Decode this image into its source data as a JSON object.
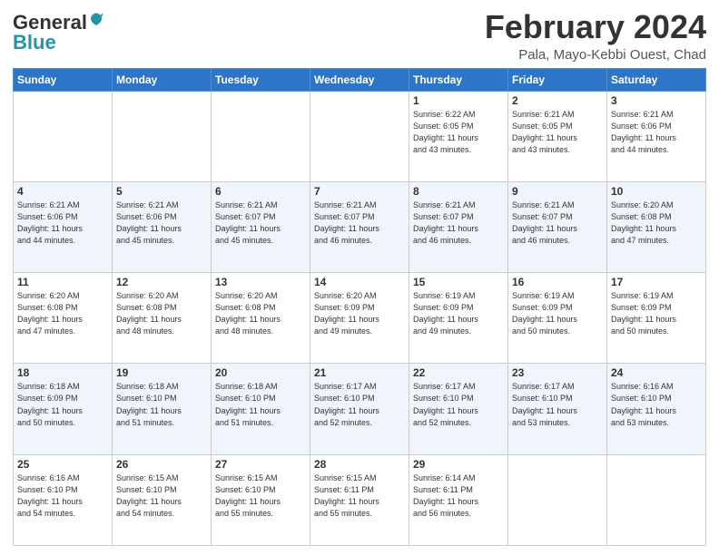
{
  "header": {
    "logo_line1": "General",
    "logo_line2": "Blue",
    "month": "February 2024",
    "location": "Pala, Mayo-Kebbi Ouest, Chad"
  },
  "days_of_week": [
    "Sunday",
    "Monday",
    "Tuesday",
    "Wednesday",
    "Thursday",
    "Friday",
    "Saturday"
  ],
  "weeks": [
    [
      {
        "day": "",
        "info": ""
      },
      {
        "day": "",
        "info": ""
      },
      {
        "day": "",
        "info": ""
      },
      {
        "day": "",
        "info": ""
      },
      {
        "day": "1",
        "info": "Sunrise: 6:22 AM\nSunset: 6:05 PM\nDaylight: 11 hours\nand 43 minutes."
      },
      {
        "day": "2",
        "info": "Sunrise: 6:21 AM\nSunset: 6:05 PM\nDaylight: 11 hours\nand 43 minutes."
      },
      {
        "day": "3",
        "info": "Sunrise: 6:21 AM\nSunset: 6:06 PM\nDaylight: 11 hours\nand 44 minutes."
      }
    ],
    [
      {
        "day": "4",
        "info": "Sunrise: 6:21 AM\nSunset: 6:06 PM\nDaylight: 11 hours\nand 44 minutes."
      },
      {
        "day": "5",
        "info": "Sunrise: 6:21 AM\nSunset: 6:06 PM\nDaylight: 11 hours\nand 45 minutes."
      },
      {
        "day": "6",
        "info": "Sunrise: 6:21 AM\nSunset: 6:07 PM\nDaylight: 11 hours\nand 45 minutes."
      },
      {
        "day": "7",
        "info": "Sunrise: 6:21 AM\nSunset: 6:07 PM\nDaylight: 11 hours\nand 46 minutes."
      },
      {
        "day": "8",
        "info": "Sunrise: 6:21 AM\nSunset: 6:07 PM\nDaylight: 11 hours\nand 46 minutes."
      },
      {
        "day": "9",
        "info": "Sunrise: 6:21 AM\nSunset: 6:07 PM\nDaylight: 11 hours\nand 46 minutes."
      },
      {
        "day": "10",
        "info": "Sunrise: 6:20 AM\nSunset: 6:08 PM\nDaylight: 11 hours\nand 47 minutes."
      }
    ],
    [
      {
        "day": "11",
        "info": "Sunrise: 6:20 AM\nSunset: 6:08 PM\nDaylight: 11 hours\nand 47 minutes."
      },
      {
        "day": "12",
        "info": "Sunrise: 6:20 AM\nSunset: 6:08 PM\nDaylight: 11 hours\nand 48 minutes."
      },
      {
        "day": "13",
        "info": "Sunrise: 6:20 AM\nSunset: 6:08 PM\nDaylight: 11 hours\nand 48 minutes."
      },
      {
        "day": "14",
        "info": "Sunrise: 6:20 AM\nSunset: 6:09 PM\nDaylight: 11 hours\nand 49 minutes."
      },
      {
        "day": "15",
        "info": "Sunrise: 6:19 AM\nSunset: 6:09 PM\nDaylight: 11 hours\nand 49 minutes."
      },
      {
        "day": "16",
        "info": "Sunrise: 6:19 AM\nSunset: 6:09 PM\nDaylight: 11 hours\nand 50 minutes."
      },
      {
        "day": "17",
        "info": "Sunrise: 6:19 AM\nSunset: 6:09 PM\nDaylight: 11 hours\nand 50 minutes."
      }
    ],
    [
      {
        "day": "18",
        "info": "Sunrise: 6:18 AM\nSunset: 6:09 PM\nDaylight: 11 hours\nand 50 minutes."
      },
      {
        "day": "19",
        "info": "Sunrise: 6:18 AM\nSunset: 6:10 PM\nDaylight: 11 hours\nand 51 minutes."
      },
      {
        "day": "20",
        "info": "Sunrise: 6:18 AM\nSunset: 6:10 PM\nDaylight: 11 hours\nand 51 minutes."
      },
      {
        "day": "21",
        "info": "Sunrise: 6:17 AM\nSunset: 6:10 PM\nDaylight: 11 hours\nand 52 minutes."
      },
      {
        "day": "22",
        "info": "Sunrise: 6:17 AM\nSunset: 6:10 PM\nDaylight: 11 hours\nand 52 minutes."
      },
      {
        "day": "23",
        "info": "Sunrise: 6:17 AM\nSunset: 6:10 PM\nDaylight: 11 hours\nand 53 minutes."
      },
      {
        "day": "24",
        "info": "Sunrise: 6:16 AM\nSunset: 6:10 PM\nDaylight: 11 hours\nand 53 minutes."
      }
    ],
    [
      {
        "day": "25",
        "info": "Sunrise: 6:16 AM\nSunset: 6:10 PM\nDaylight: 11 hours\nand 54 minutes."
      },
      {
        "day": "26",
        "info": "Sunrise: 6:15 AM\nSunset: 6:10 PM\nDaylight: 11 hours\nand 54 minutes."
      },
      {
        "day": "27",
        "info": "Sunrise: 6:15 AM\nSunset: 6:10 PM\nDaylight: 11 hours\nand 55 minutes."
      },
      {
        "day": "28",
        "info": "Sunrise: 6:15 AM\nSunset: 6:11 PM\nDaylight: 11 hours\nand 55 minutes."
      },
      {
        "day": "29",
        "info": "Sunrise: 6:14 AM\nSunset: 6:11 PM\nDaylight: 11 hours\nand 56 minutes."
      },
      {
        "day": "",
        "info": ""
      },
      {
        "day": "",
        "info": ""
      }
    ]
  ]
}
